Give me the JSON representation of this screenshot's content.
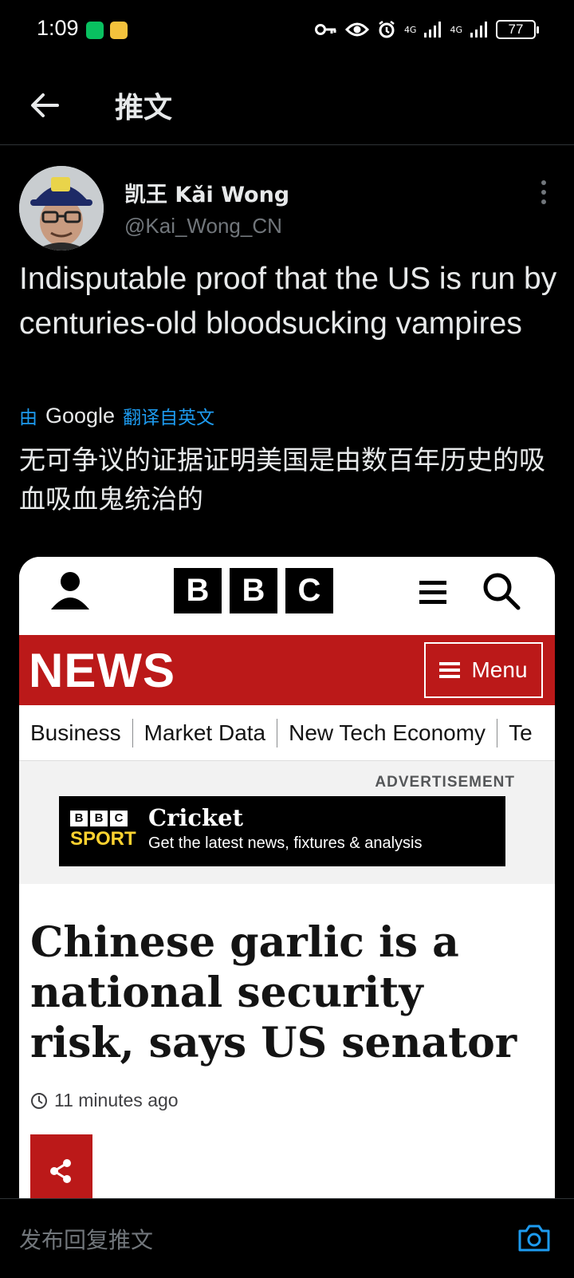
{
  "status_bar": {
    "time": "1:09",
    "signal_1": "4G",
    "signal_2": "4G",
    "battery": "77"
  },
  "header": {
    "title": "推文"
  },
  "author": {
    "name": "凯王 Kǎi Wong",
    "handle": "@Kai_Wong_CN"
  },
  "tweet": {
    "text": "Indisputable proof that the US is run by centuries-old bloodsucking vampires",
    "translate_prefix": "由",
    "translate_brand": "Google",
    "translate_suffix": "翻译自英文",
    "translated_text": "无可争议的证据证明美国是由数百年历史的吸血吸血鬼统治的"
  },
  "embed": {
    "logo_letters": [
      "B",
      "B",
      "C"
    ],
    "news_label": "NEWS",
    "menu_label": "Menu",
    "sub_nav": [
      "Business",
      "Market Data",
      "New Tech Economy",
      "Te"
    ],
    "ad_label": "ADVERTISEMENT",
    "ad_brand_letters": [
      "B",
      "B",
      "C"
    ],
    "ad_sport": "SPORT",
    "ad_title": "Cricket",
    "ad_subtitle": "Get the latest news, fixtures & analysis",
    "headline": "Chinese garlic is a national security risk, says US senator",
    "timestamp": "11 minutes ago"
  },
  "reply": {
    "placeholder": "发布回复推文"
  },
  "colors": {
    "accent": "#1d9bf0",
    "bbc_red": "#bb1919",
    "sport_yellow": "#ffd230"
  },
  "icons": [
    "back-arrow-icon",
    "more-vertical-icon",
    "user-icon",
    "hamburger-icon",
    "search-icon",
    "clock-icon",
    "share-icon",
    "camera-icon"
  ]
}
